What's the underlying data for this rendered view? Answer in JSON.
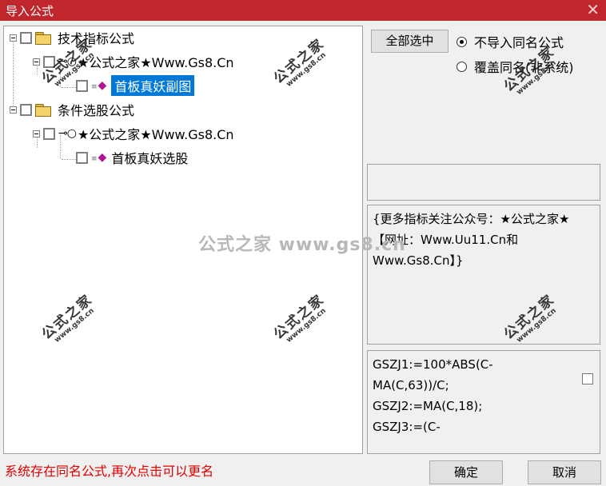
{
  "window": {
    "title": "导入公式",
    "close_glyph": "✕"
  },
  "tree": {
    "nodes": [
      {
        "label": "技术指标公式"
      },
      {
        "label": "★公式之家★Www.Gs8.Cn",
        "key_glyph": "⊸○"
      },
      {
        "label": "首板真妖副图",
        "selected": true,
        "gem_glyph": "◆"
      },
      {
        "label": "条件选股公式"
      },
      {
        "label": "★公式之家★Www.Gs8.Cn",
        "key_glyph": "⊸○"
      },
      {
        "label": "首板真妖选股",
        "gem_glyph": "◆"
      }
    ]
  },
  "options": {
    "select_all_label": "全部选中",
    "radio_no_import": "不导入同名公式",
    "radio_overwrite": "覆盖同名(非系统)",
    "selected_radio": "不导入同名公式"
  },
  "info": {
    "text": "{更多指标关注公众号：★公式之家★ 【网址：Www.Uu11.Cn和Www.Gs8.Cn】}"
  },
  "code": {
    "text": "GSZJ1:=100*ABS(C-MA(C,63))/C;\nGSZJ2:=MA(C,18);\nGSZJ3:=(C-"
  },
  "status": {
    "text": "系统存在同名公式,再次点击可以更名"
  },
  "buttons": {
    "ok": "确定",
    "cancel": "取消"
  },
  "watermarks": {
    "small_main": "公式之家",
    "small_sub": "www.gs8.cn",
    "big": "公式之家 www.gs8.cn"
  },
  "colors": {
    "titlebar": "#c0272d",
    "selection": "#0078d7",
    "status": "#e00000"
  }
}
